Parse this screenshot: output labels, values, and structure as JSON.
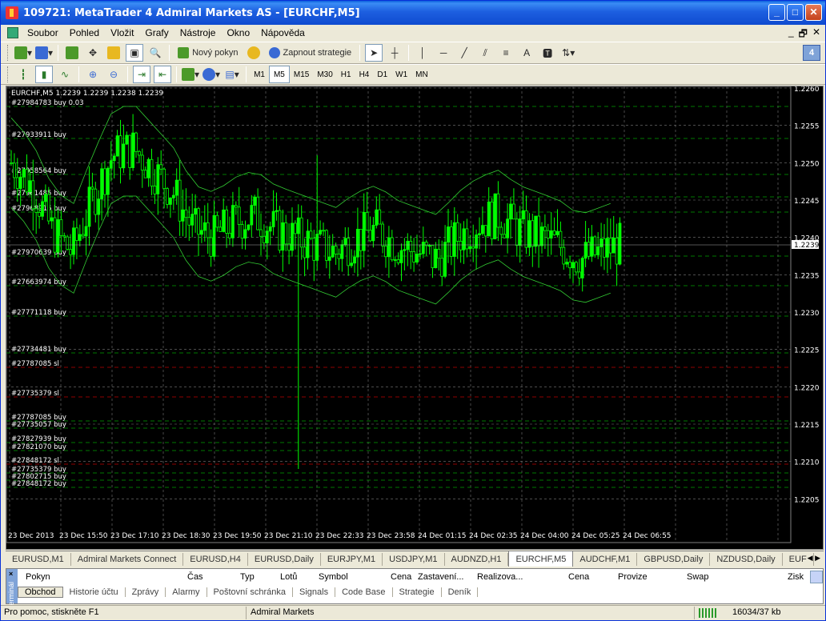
{
  "window": {
    "title": "109721: MetaTrader 4 Admiral Markets AS - [EURCHF,M5]",
    "buttons": {
      "minimize": "_",
      "maximize": "□",
      "close": "✕"
    }
  },
  "menu": [
    "Soubor",
    "Pohled",
    "Vložit",
    "Grafy",
    "Nástroje",
    "Okno",
    "Nápověda"
  ],
  "mdi_buttons": [
    "_",
    "🗗",
    "✕"
  ],
  "toolbar1": {
    "new_order": "Nový pokyn",
    "auto_trading": "Zapnout strategie",
    "text_tool": "A",
    "info_icon": "4"
  },
  "timeframes": [
    "M1",
    "M5",
    "M15",
    "M30",
    "H1",
    "H4",
    "D1",
    "W1",
    "MN"
  ],
  "timeframe_active": "M5",
  "chart": {
    "symbol_info": "EURCHF,M5  1.2239 1.2239 1.2238 1.2239",
    "current_price": "1.2239",
    "order_labels": [
      "#27984783 buy 0.03",
      "#27933911 buy",
      "#27958564 buy",
      "#27961485 buy",
      "#27968916 buy",
      "#27970639 buy",
      "#27663974 buy",
      "#27771118 buy",
      "#27734481 buy",
      "#27787085 sl",
      "#27735379 sl",
      "#27787085 buy",
      "#27735057 buy",
      "#27827939 buy",
      "#27821070 buy",
      "#27848172 sl",
      "#27735379 buy",
      "#27802715 buy",
      "#27848172 buy"
    ],
    "price_ticks": [
      "1.2260",
      "1.2255",
      "1.2250",
      "1.2245",
      "1.2240",
      "1.2235",
      "1.2230",
      "1.2225",
      "1.2220",
      "1.2215",
      "1.2210",
      "1.2205"
    ],
    "time_ticks": [
      "23 Dec 2013",
      "23 Dec 15:50",
      "23 Dec 17:10",
      "23 Dec 18:30",
      "23 Dec 19:50",
      "23 Dec 21:10",
      "23 Dec 22:33",
      "23 Dec 23:58",
      "24 Dec 01:15",
      "24 Dec 02:35",
      "24 Dec 04:00",
      "24 Dec 05:25",
      "24 Dec 06:55"
    ],
    "colors": {
      "background": "#000000",
      "candles": "#00ff00",
      "grid": "#7a7a7a",
      "buy_lines": "#00a000",
      "sl_lines": "#c00000"
    }
  },
  "chart_tabs": [
    "EURUSD,M1",
    "Admiral Markets Connect",
    "EURUSD,H4",
    "EURUSD,Daily",
    "EURJPY,M1",
    "USDJPY,M1",
    "AUDNZD,H1",
    "EURCHF,M5",
    "AUDCHF,M1",
    "GBPUSD,Daily",
    "NZDUSD,Daily",
    "EUF"
  ],
  "chart_tab_active": "EURCHF,M5",
  "terminal": {
    "side_label": "Terminál",
    "columns": [
      "Pokyn",
      "Čas",
      "Typ",
      "Lotů",
      "Symbol",
      "Cena",
      "Zastavení...",
      "Realizova...",
      "Cena",
      "Provize",
      "Swap",
      "Zisk"
    ],
    "tabs": [
      "Obchod",
      "Historie účtu",
      "Zprávy",
      "Alarmy",
      "Poštovní schránka",
      "Signals",
      "Code Base",
      "Strategie",
      "Deník"
    ],
    "tab_active": "Obchod"
  },
  "status": {
    "help": "Pro pomoc, stiskněte F1",
    "broker": "Admiral Markets",
    "traffic": "16034/37 kb"
  }
}
